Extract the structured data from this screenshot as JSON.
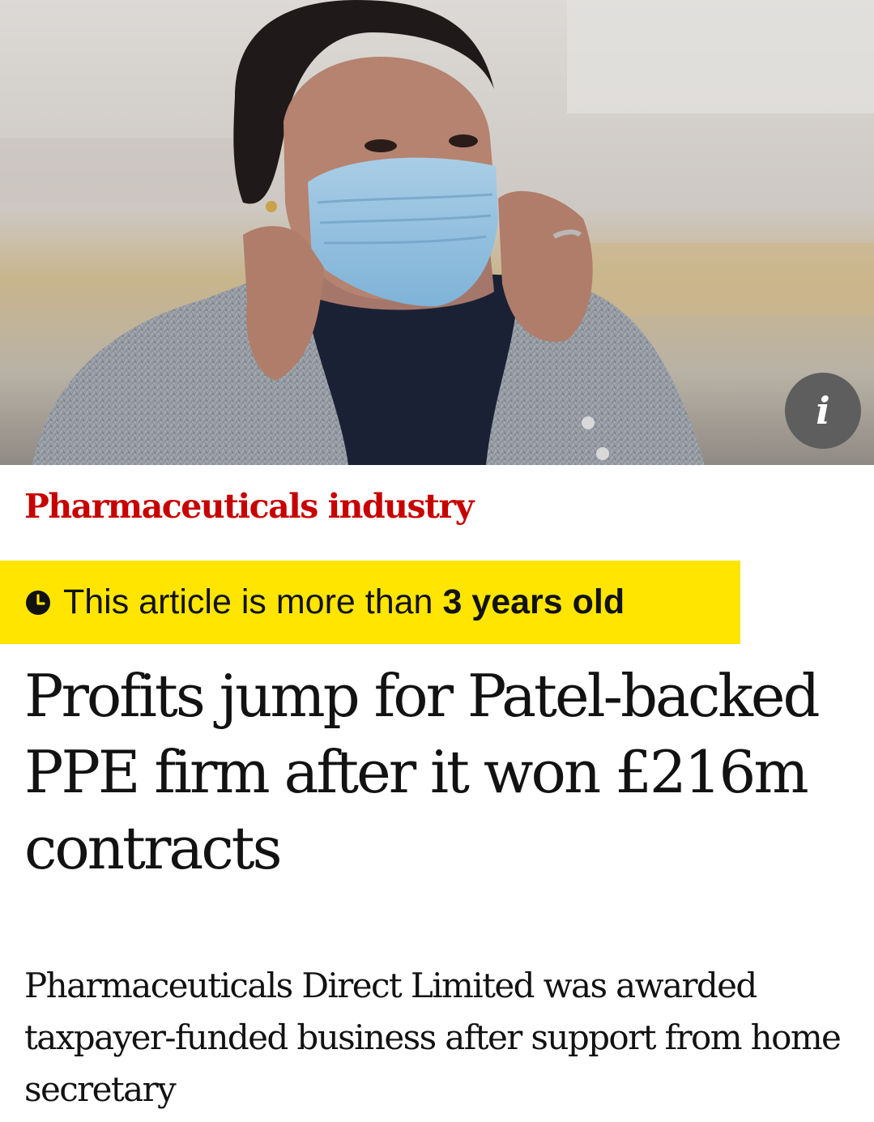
{
  "hero": {
    "image_alt": "",
    "info_icon": "info-icon",
    "info_label": "i"
  },
  "article": {
    "section": "Pharmaceuticals industry",
    "age_warning": {
      "icon": "clock-icon",
      "prefix": "This article is more than",
      "emphasis": "3 years old"
    },
    "headline": "Profits jump for Patel-backed PPE firm after it won £216m contracts",
    "standfirst": "Pharmaceuticals Direct Limited was awarded taxpayer-funded business after support from home secretary"
  },
  "colors": {
    "section": "#c70000",
    "warning_bg": "#ffe500",
    "text": "#121212",
    "info_button": "#5e5e5e"
  }
}
